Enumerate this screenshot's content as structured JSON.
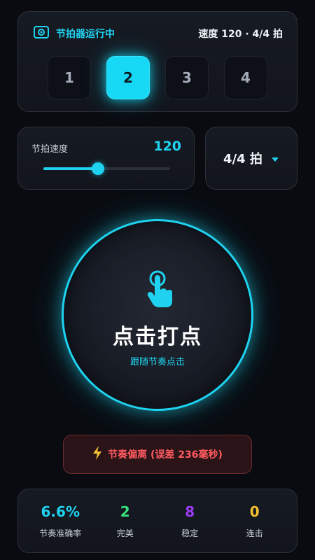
{
  "status": {
    "icon": "metronome-icon",
    "text": "节拍器运行中",
    "summary": "速度 120 · 4/4 拍"
  },
  "beats": {
    "items": [
      "1",
      "2",
      "3",
      "4"
    ],
    "active_index": 1
  },
  "tempo": {
    "label": "节拍速度",
    "value": "120",
    "slider_fraction": 0.43
  },
  "meter": {
    "label": "4/4 拍",
    "icon": "caret-down-icon"
  },
  "tap": {
    "icon": "tap-hand-icon",
    "title": "点击打点",
    "subtitle": "跟随节奏点击"
  },
  "warning": {
    "icon": "lightning-icon",
    "text": "节奏偏离 (误差 236毫秒)"
  },
  "stats": [
    {
      "value": "6.6%",
      "label": "节奏准确率",
      "color": "#1fd3f0"
    },
    {
      "value": "2",
      "label": "完美",
      "color": "#36e07a"
    },
    {
      "value": "8",
      "label": "稳定",
      "color": "#9b3cf5"
    },
    {
      "value": "0",
      "label": "连击",
      "color": "#f5c02f"
    }
  ],
  "colors": {
    "accent": "#1fd3f0",
    "danger": "#ff5a5f",
    "background": "#090b10"
  }
}
